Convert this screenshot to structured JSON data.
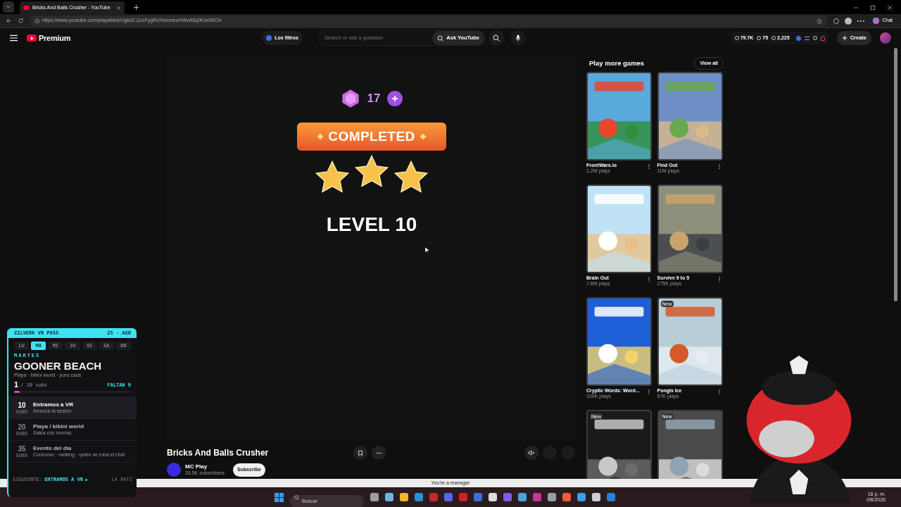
{
  "browser": {
    "tab_title": "Bricks And Balls Crusher - YouTube",
    "url": "https://www.youtube.com/playables/UgkxZ-ZzoFygRxXtcmneuHWzA6q0Kar9ACIv",
    "chat_button": "Chat"
  },
  "header": {
    "logo": "Premium",
    "filter_chip": "Los filtros",
    "search_placeholder": "Search or ask a question",
    "ask_button": "Ask YouTube",
    "stats": [
      "79.7K",
      "75",
      "2,225"
    ],
    "create_button": "Create"
  },
  "game": {
    "gems": "17",
    "banner": "COMPLETED",
    "stars": 3,
    "level": "LEVEL 10",
    "title": "Bricks And Balls Crusher",
    "channel": "MC Play",
    "subscribers": "26.5K subscribers",
    "subscribe_button": "Subscribe"
  },
  "sidebar": {
    "title": "Play more games",
    "view_all": "View all",
    "games": [
      {
        "title": "FrontWars.io",
        "plays": "1.2M plays"
      },
      {
        "title": "Find Out",
        "plays": "11M plays"
      },
      {
        "title": "Brain Out",
        "plays": "7.6M plays"
      },
      {
        "title": "Survive 9 to 5",
        "plays": "275K plays"
      },
      {
        "title": "Cryptic Words: Word...",
        "plays": "100K plays"
      },
      {
        "title": "Pongis Ice",
        "plays": "67K plays",
        "badge": "New"
      },
      {
        "badge": "New"
      },
      {
        "badge": "New"
      }
    ]
  },
  "overlay": {
    "header": "ZILVERK VR PASS",
    "date": "25 · AGO",
    "days": [
      {
        "label": "LU",
        "selected": false
      },
      {
        "label": "MA",
        "selected": true
      },
      {
        "label": "MI",
        "selected": false
      },
      {
        "label": "JU",
        "selected": false
      },
      {
        "label": "VI",
        "selected": false
      },
      {
        "label": "SA",
        "selected": false
      },
      {
        "label": "DO",
        "selected": false
      }
    ],
    "day_name": "MARTES",
    "headline": "GOONER BEACH",
    "subtitle": "Playa · bikini world · puro caos",
    "count": "1",
    "goal": "/ 10 subs",
    "remaining": "FALTAN 9",
    "level": 0.05,
    "milestones": [
      {
        "number": "10",
        "unit": "SUBS",
        "title": "Entramos a VR",
        "description": "Arranca la sesión",
        "reached": true
      },
      {
        "number": "20",
        "unit": "SUBS",
        "title": "Playa / bikini world",
        "description": "Salsa con morras",
        "reached": false
      },
      {
        "number": "35",
        "unit": "SUBS",
        "title": "Evento del dia",
        "description": "Concurso · ranking · quién se roba el chat",
        "reached": false
      }
    ],
    "footer_label": "SIGUIENTE:",
    "footer_next": "ENTRAMOS A VR",
    "footer_right": "LA RATZ"
  },
  "notification": "You're a manager",
  "taskbar": {
    "search_placeholder": "Buscar",
    "time": "18 p. m.",
    "date": "/08/2026"
  }
}
